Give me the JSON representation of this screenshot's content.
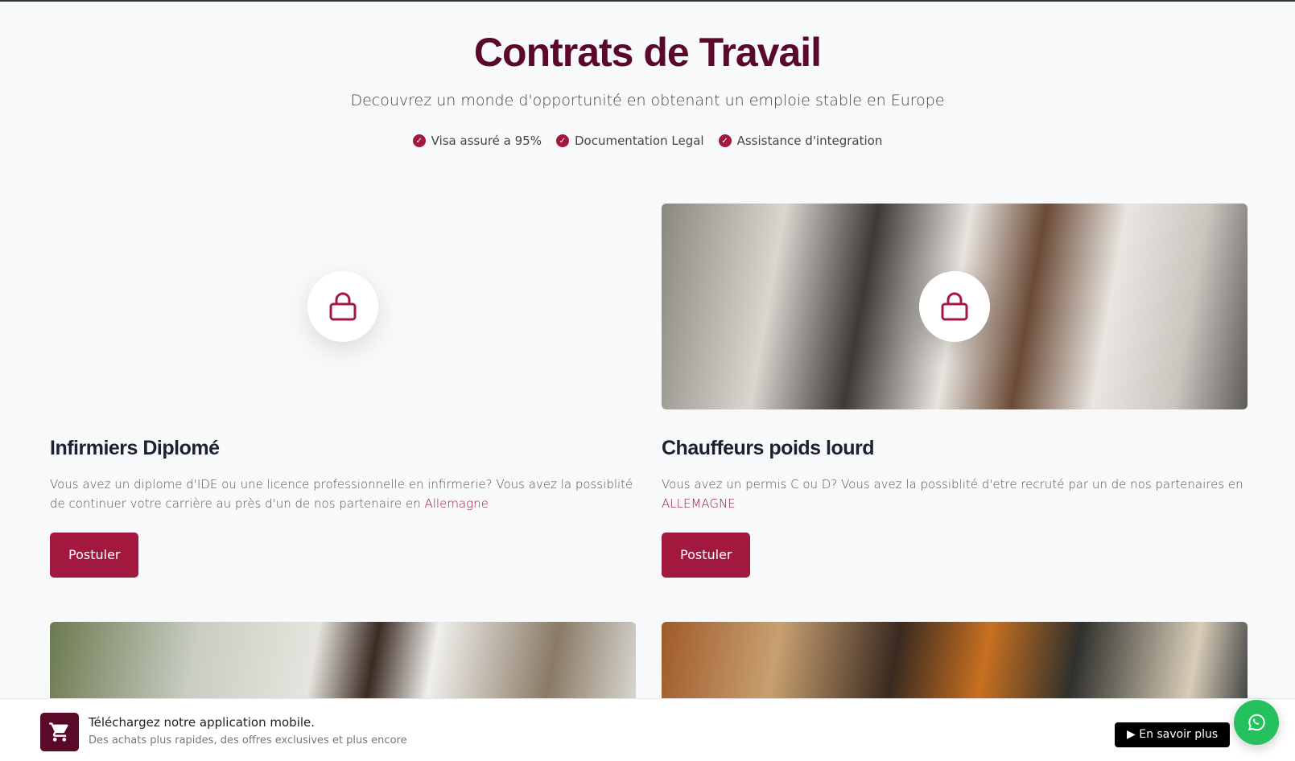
{
  "header": {
    "title": "Contrats de Travail",
    "subtitle": "Decouvrez un monde d'opportunité en obtenant un emploie stable en Europe",
    "features": [
      "Visa assuré a 95%",
      "Documentation Legal",
      "Assistance d'integration"
    ]
  },
  "cards": [
    {
      "title": "Infirmiers Diplomé",
      "desc": "Vous avez un diplome d'IDE ou une licence professionnelle en infirmerie? Vous avez la possiblité de continuer votre carrière au près d'un de nos partenaire en ",
      "link": "Allemagne",
      "button": "Postuler"
    },
    {
      "title": "Chauffeurs poids lourd",
      "desc": "Vous avez un permis C ou D? Vous avez la possiblité d'etre recruté par un de nos partenaires en ",
      "link": "ALLEMAGNE",
      "button": "Postuler"
    }
  ],
  "app_banner": {
    "title": "Téléchargez notre application mobile.",
    "subtitle": "Des achats plus rapides, des offres exclusives et plus encore",
    "button": "En savoir plus"
  },
  "colors": {
    "accent": "#a3183f",
    "title": "#5a0a28",
    "whatsapp": "#25c15f"
  }
}
